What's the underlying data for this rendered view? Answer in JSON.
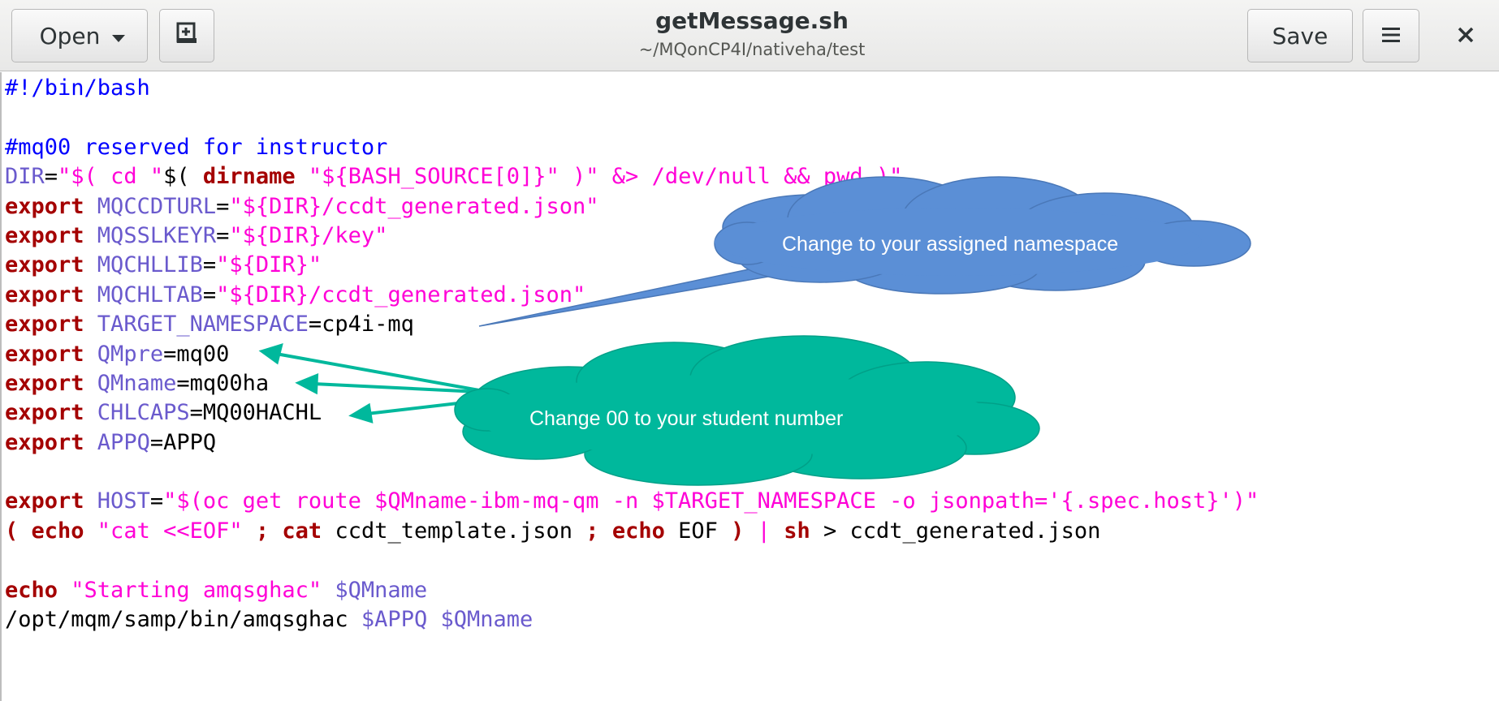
{
  "header": {
    "open_label": "Open",
    "save_label": "Save",
    "title": "getMessage.sh",
    "subtitle": "~/MQonCP4I/nativeha/test"
  },
  "icons": {
    "open_dropdown": "chevron-down-icon",
    "new_tab": "new-document-icon",
    "menu": "hamburger-menu-icon",
    "close": "close-icon"
  },
  "colors": {
    "keyword": "#a40000",
    "string": "#ff00d7",
    "variable": "#6a5acd",
    "comment": "#0000ff",
    "callout_blue": "#5b8fd6",
    "callout_teal": "#00b89c"
  },
  "code_lines": [
    [
      {
        "t": "#!/bin/bash",
        "c": "cmt"
      }
    ],
    [],
    [
      {
        "t": "#mq00 reserved for instructor",
        "c": "cmt"
      }
    ],
    [
      {
        "t": "DIR",
        "c": "var"
      },
      {
        "t": "=",
        "c": "norm"
      },
      {
        "t": "\"$( cd \"",
        "c": "str"
      },
      {
        "t": "$( ",
        "c": "norm"
      },
      {
        "t": "dirname",
        "c": "kw"
      },
      {
        "t": " \"${BASH_SOURCE[0]}\" )\" &> /dev/null && pwd )\"",
        "c": "str"
      }
    ],
    [
      {
        "t": "export",
        "c": "kw"
      },
      {
        "t": " MQCCDTURL",
        "c": "var"
      },
      {
        "t": "=",
        "c": "norm"
      },
      {
        "t": "\"${DIR}/ccdt_generated.json\"",
        "c": "str"
      }
    ],
    [
      {
        "t": "export",
        "c": "kw"
      },
      {
        "t": " MQSSLKEYR",
        "c": "var"
      },
      {
        "t": "=",
        "c": "norm"
      },
      {
        "t": "\"${DIR}/key\"",
        "c": "str"
      }
    ],
    [
      {
        "t": "export",
        "c": "kw"
      },
      {
        "t": " MQCHLLIB",
        "c": "var"
      },
      {
        "t": "=",
        "c": "norm"
      },
      {
        "t": "\"${DIR}\"",
        "c": "str"
      }
    ],
    [
      {
        "t": "export",
        "c": "kw"
      },
      {
        "t": " MQCHLTAB",
        "c": "var"
      },
      {
        "t": "=",
        "c": "norm"
      },
      {
        "t": "\"${DIR}/ccdt_generated.json\"",
        "c": "str"
      }
    ],
    [
      {
        "t": "export",
        "c": "kw"
      },
      {
        "t": " TARGET_NAMESPACE",
        "c": "var"
      },
      {
        "t": "=cp4i-mq",
        "c": "norm"
      }
    ],
    [
      {
        "t": "export",
        "c": "kw"
      },
      {
        "t": " QMpre",
        "c": "var"
      },
      {
        "t": "=mq00",
        "c": "norm"
      }
    ],
    [
      {
        "t": "export",
        "c": "kw"
      },
      {
        "t": " QMname",
        "c": "var"
      },
      {
        "t": "=mq00ha",
        "c": "norm"
      }
    ],
    [
      {
        "t": "export",
        "c": "kw"
      },
      {
        "t": " CHLCAPS",
        "c": "var"
      },
      {
        "t": "=MQ00HACHL",
        "c": "norm"
      }
    ],
    [
      {
        "t": "export",
        "c": "kw"
      },
      {
        "t": " APPQ",
        "c": "var"
      },
      {
        "t": "=APPQ",
        "c": "norm"
      }
    ],
    [],
    [
      {
        "t": "export",
        "c": "kw"
      },
      {
        "t": " HOST",
        "c": "var"
      },
      {
        "t": "=",
        "c": "norm"
      },
      {
        "t": "\"$(oc get route $QMname-ibm-mq-qm -n $TARGET_NAMESPACE -o jsonpath='{.spec.host}')\"",
        "c": "str"
      }
    ],
    [
      {
        "t": "( ",
        "c": "kw"
      },
      {
        "t": "echo",
        "c": "kw"
      },
      {
        "t": " \"cat <<EOF\"",
        "c": "str"
      },
      {
        "t": " ; ",
        "c": "kw"
      },
      {
        "t": "cat",
        "c": "kw"
      },
      {
        "t": " ccdt_template.json ",
        "c": "norm"
      },
      {
        "t": ";",
        "c": "kw"
      },
      {
        "t": " ",
        "c": "norm"
      },
      {
        "t": "echo",
        "c": "kw"
      },
      {
        "t": " EOF ",
        "c": "norm"
      },
      {
        "t": ")",
        "c": "kw"
      },
      {
        "t": " ",
        "c": "norm"
      },
      {
        "t": "|",
        "c": "str"
      },
      {
        "t": " ",
        "c": "norm"
      },
      {
        "t": "sh",
        "c": "kw"
      },
      {
        "t": " > ccdt_generated.json",
        "c": "norm"
      }
    ],
    [],
    [
      {
        "t": "echo",
        "c": "kw"
      },
      {
        "t": " \"Starting amqsghac\"",
        "c": "str"
      },
      {
        "t": " $QMname",
        "c": "var"
      }
    ],
    [
      {
        "t": "/opt/",
        "c": "norm"
      },
      {
        "t": "mqm",
        "c": "norm"
      },
      {
        "t": "/samp/bin/amqsghac ",
        "c": "norm"
      },
      {
        "t": "$APPQ $QMname",
        "c": "var"
      }
    ]
  ],
  "callouts": {
    "namespace_text": "Change to your assigned namespace",
    "student_text": "Change 00 to your student number"
  }
}
